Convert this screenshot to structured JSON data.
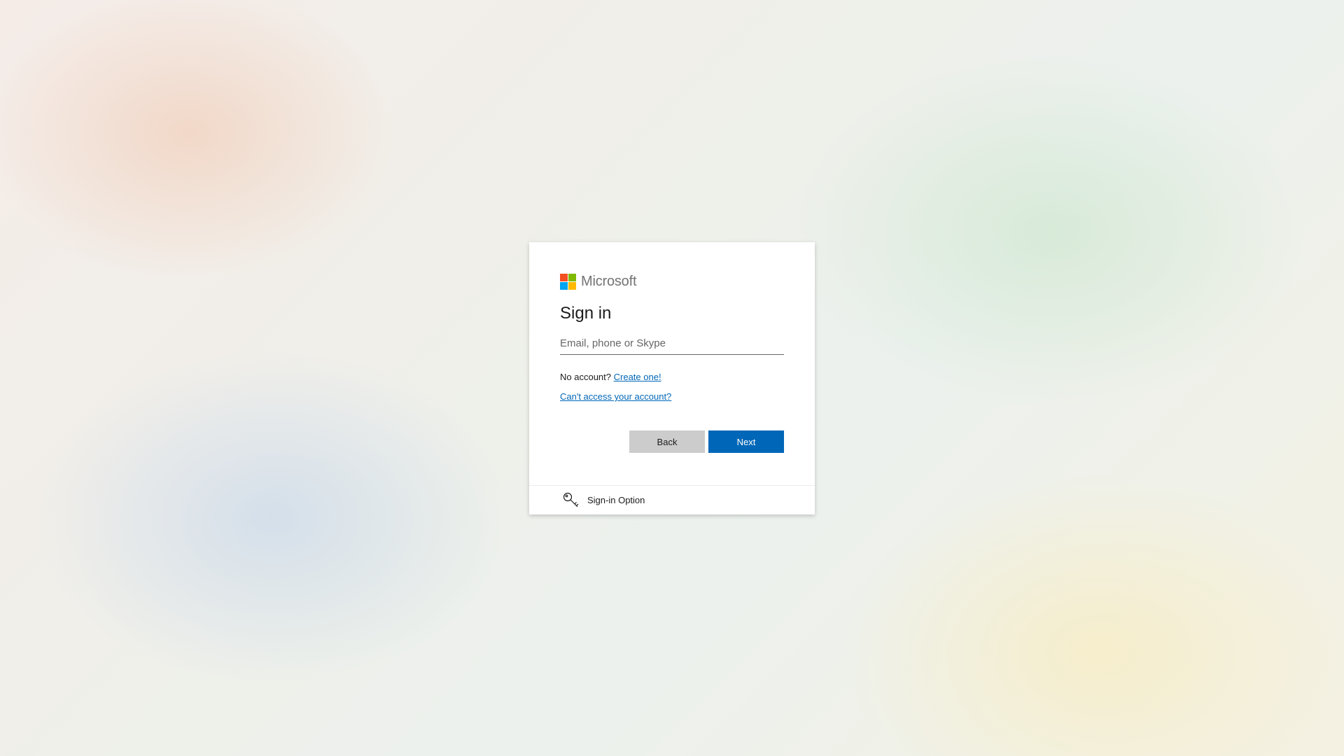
{
  "brand": {
    "name": "Microsoft",
    "logo_colors": [
      "#f25022",
      "#7fba00",
      "#00a4ef",
      "#ffb900"
    ]
  },
  "signin": {
    "title": "Sign in",
    "input_placeholder": "Email, phone or Skype",
    "input_value": "",
    "no_account_text": "No account?",
    "create_link": "Create one!",
    "cant_access_link": "Can't access your account?"
  },
  "buttons": {
    "back": "Back",
    "next": "Next"
  },
  "options": {
    "label": "Sign-in Option",
    "icon": "key-icon"
  },
  "colors": {
    "accent": "#0067b8",
    "back_button": "#cccccc"
  }
}
